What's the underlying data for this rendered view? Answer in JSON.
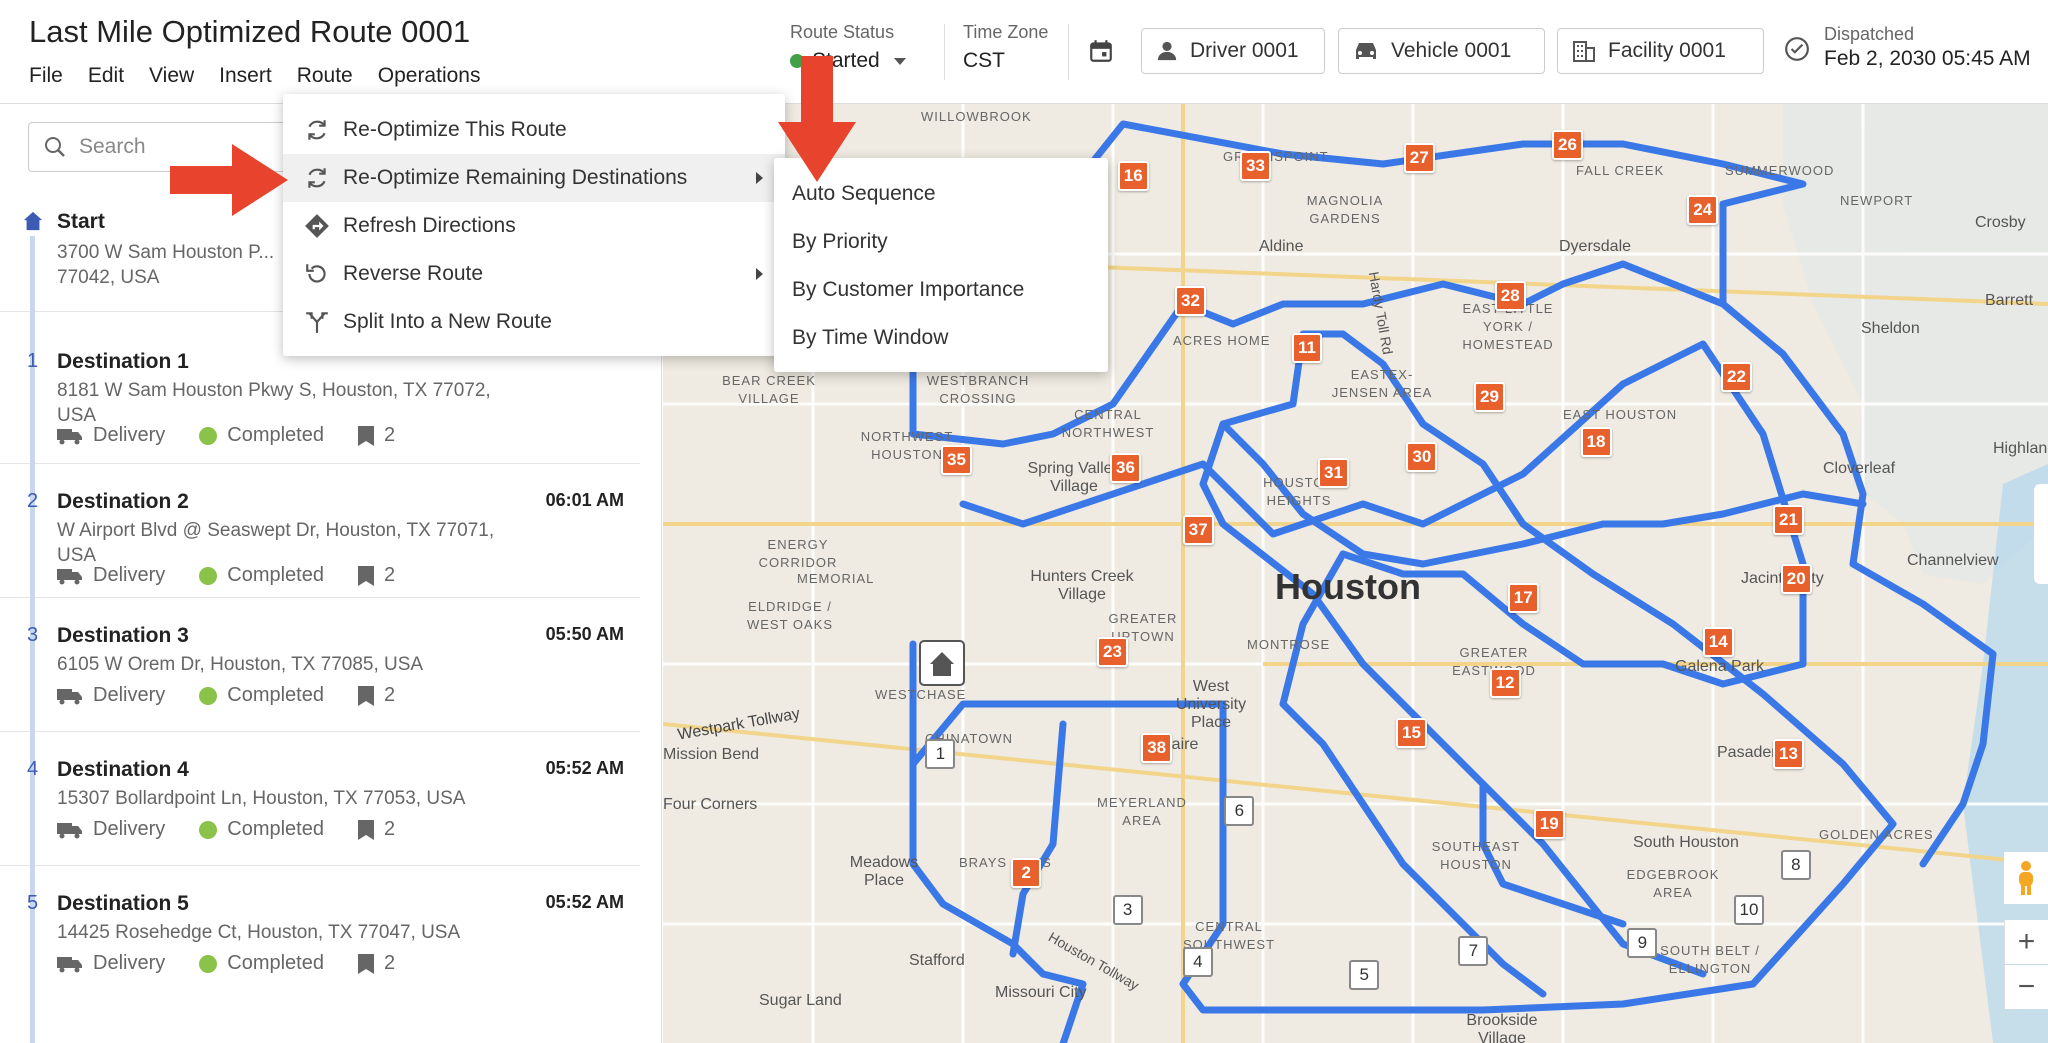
{
  "header": {
    "title": "Last Mile Optimized Route 0001",
    "menus": [
      "File",
      "Edit",
      "View",
      "Insert",
      "Route",
      "Operations"
    ],
    "route_status_label": "Route Status",
    "route_status_value": "Started",
    "time_zone_label": "Time Zone",
    "time_zone_value": "CST",
    "driver": "Driver 0001",
    "vehicle": "Vehicle 0001",
    "facility": "Facility 0001",
    "dispatched_label": "Dispatched",
    "dispatched_value": "Feb 2, 2030 05:45 AM"
  },
  "sidebar": {
    "search_placeholder": "Search",
    "start": {
      "name": "Start",
      "address": "3700 W Sam Houston P... 77042, USA"
    },
    "stops": [
      {
        "num": "1",
        "name": "Destination 1",
        "address": "8181 W Sam Houston Pkwy S, Houston, TX 77072, USA",
        "time": "",
        "type": "Delivery",
        "status": "Completed",
        "count": "2"
      },
      {
        "num": "2",
        "name": "Destination 2",
        "address": "W Airport Blvd @ Seaswept Dr, Houston, TX 77071, USA",
        "time": "06:01 AM",
        "type": "Delivery",
        "status": "Completed",
        "count": "2"
      },
      {
        "num": "3",
        "name": "Destination 3",
        "address": "6105 W Orem Dr, Houston, TX 77085, USA",
        "time": "05:50 AM",
        "type": "Delivery",
        "status": "Completed",
        "count": "2"
      },
      {
        "num": "4",
        "name": "Destination 4",
        "address": "15307 Bollardpoint Ln, Houston, TX 77053, USA",
        "time": "05:52 AM",
        "type": "Delivery",
        "status": "Completed",
        "count": "2"
      },
      {
        "num": "5",
        "name": "Destination 5",
        "address": "14425 Rosehedge Ct, Houston, TX 77047, USA",
        "time": "05:52 AM",
        "type": "Delivery",
        "status": "Completed",
        "count": "2"
      }
    ]
  },
  "route_menu": {
    "items": [
      {
        "label": "Re-Optimize This Route",
        "icon": "refresh-icon",
        "submenu": false
      },
      {
        "label": "Re-Optimize Remaining Destinations",
        "icon": "refresh-icon",
        "submenu": true
      },
      {
        "label": "Refresh Directions",
        "icon": "directions-icon",
        "submenu": false
      },
      {
        "label": "Reverse Route",
        "icon": "reverse-icon",
        "submenu": true
      },
      {
        "label": "Split Into a New Route",
        "icon": "split-icon",
        "submenu": false
      }
    ]
  },
  "submenu": {
    "items": [
      "Auto Sequence",
      "By Priority",
      "By Customer Importance",
      "By Time Window"
    ]
  },
  "map": {
    "city_label": "Houston",
    "labels": [
      "WILLOWBROOK",
      "GREENSPOINT",
      "FALL CREEK",
      "SUMMERWOOD",
      "NEWPORT",
      "Crosby",
      "MAGNOLIA GARDENS",
      "Aldine",
      "Dyersdale",
      "Barrett",
      "Sheldon",
      "EAST LITTLE YORK / HOMESTEAD",
      "ACRES HOME",
      "EASTEX-JENSEN AREA",
      "BEAR CREEK VILLAGE",
      "WESTBRANCH CROSSING",
      "CENTRAL NORTHWEST",
      "EAST HOUSTON",
      "Highlands",
      "NORTHWEST HOUSTON",
      "HOUSTON HEIGHTS",
      "Spring Valley Village",
      "Cloverleaf",
      "ENERGY CORRIDOR",
      "MEMORIAL",
      "Hunters Creek Village",
      "Jacinto City",
      "Channelview",
      "ELDRIDGE / WEST OAKS",
      "GREATER UPTOWN",
      "MONTROSE",
      "GREATER EASTWOOD",
      "Galena Park",
      "WESTCHASE",
      "West University Place",
      "Westpark Tollway",
      "CHINATOWN",
      "Bellaire",
      "Pasadena",
      "Mission Bend",
      "Four Corners",
      "MEYERLAND AREA",
      "GOLDEN ACRES",
      "SOUTHEAST HOUSTON",
      "South Houston",
      "Meadows Place",
      "BRAYS OAKS",
      "EDGEBROOK AREA",
      "CENTRAL SOUTHWEST",
      "SOUTH BELT / ELLINGTON",
      "Stafford",
      "Sugar Land",
      "Missouri City",
      "Brookside Village",
      "Hardy Toll Rd",
      "Houston Tollway"
    ],
    "orange_markers": [
      "16",
      "33",
      "27",
      "26",
      "24",
      "32",
      "28",
      "11",
      "29",
      "22",
      "18",
      "35",
      "36",
      "31",
      "30",
      "21",
      "37",
      "20",
      "17",
      "23",
      "14",
      "12",
      "15",
      "38",
      "13",
      "19",
      "2"
    ],
    "white_markers": [
      "1",
      "6",
      "3",
      "4",
      "5",
      "7",
      "9",
      "10",
      "8"
    ],
    "zoom_in": "+",
    "zoom_out": "−"
  },
  "colors": {
    "route": "#3b78e7",
    "marker": "#e8602c",
    "arrow": "#e8432c",
    "accent": "#3b5bb5"
  }
}
